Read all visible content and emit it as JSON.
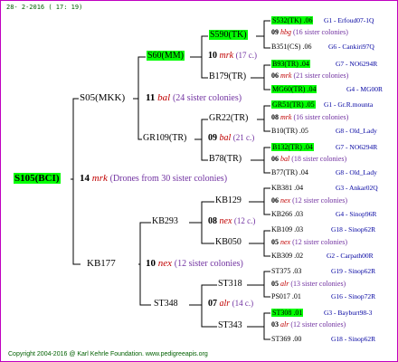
{
  "date": "28-  2-2016  ( 17: 19)",
  "copyright": "Copyright 2004-2016 @ Karl Kehrle Foundation.  www.pedigreeapis.org",
  "root": {
    "id": "S105(BCI)",
    "count": "14",
    "sym": "mrk",
    "note": "(Drones from 30 sister colonies)"
  },
  "l1": {
    "top": {
      "id": "S05(MKK)",
      "count": "11",
      "sym": "bal",
      "note": "(24 sister colonies)"
    },
    "bottom": {
      "id": "KB177",
      "count": "10",
      "sym": "nex",
      "note": "(12 sister colonies)"
    }
  },
  "l2": [
    {
      "id": "S60(MM)",
      "count": "10",
      "sym": "mrk",
      "note": "(17 c.)"
    },
    {
      "id": "GR109(TR)",
      "count": "09",
      "sym": "bal",
      "note": "(21 c.)"
    },
    {
      "id": "KB293",
      "count": "08",
      "sym": "nex",
      "note": "(12 c.)"
    },
    {
      "id": "ST348",
      "count": "07",
      "sym": "alr",
      "note": "(14 c.)"
    }
  ],
  "l3": [
    {
      "id": "S590(TK)"
    },
    {
      "id": "B179(TR)"
    },
    {
      "id": "GR22(TR)"
    },
    {
      "id": "B78(TR)"
    },
    {
      "id": "KB129"
    },
    {
      "id": "KB050"
    },
    {
      "id": "ST318"
    },
    {
      "id": "ST343"
    }
  ],
  "l4": [
    {
      "id": "S532(TK) .06",
      "loc": "G1 - Erfoud07-1Q",
      "count": "09",
      "sym": "hbg",
      "note": "(16 sister colonies)"
    },
    {
      "id": "B351(CS) .06",
      "loc": "G6 - Cankiri97Q"
    },
    {
      "id": "B93(TR) .04",
      "loc": "G7 - NO6294R",
      "count": "06",
      "sym": "mrk",
      "note": "(21 sister colonies)"
    },
    {
      "id": "MG60(TR) .04",
      "loc": "G4 - MG00R"
    },
    {
      "id": "GR51(TR) .05",
      "loc": "G1 - Gr.R.mounta",
      "count": "08",
      "sym": "mrk",
      "note": "(16 sister colonies)"
    },
    {
      "id": "B10(TR) .05",
      "loc": "G8 - Old_Lady"
    },
    {
      "id": "B132(TR) .04",
      "loc": "G7 - NO6294R",
      "count": "06",
      "sym": "bal",
      "note": "(18 sister colonies)"
    },
    {
      "id": "B77(TR) .04",
      "loc": "G8 - Old_Lady"
    },
    {
      "id": "KB381 .04",
      "loc": "G3 - Ankar02Q",
      "count": "06",
      "sym": "nex",
      "note": "(12 sister colonies)"
    },
    {
      "id": "KB266 .03",
      "loc": "G4 - Sinop96R"
    },
    {
      "id": "KB109 .03",
      "loc": "G18 - Sinop62R",
      "count": "05",
      "sym": "nex",
      "note": "(12 sister colonies)"
    },
    {
      "id": "KB309 .02",
      "loc": "G2 - Carpath00R"
    },
    {
      "id": "ST375 .03",
      "loc": "G19 - Sinop62R",
      "count": "05",
      "sym": "alr",
      "note": "(13 sister colonies)"
    },
    {
      "id": "PS017 .01",
      "loc": "G16 - Sinop72R"
    },
    {
      "id": "ST308 .01",
      "loc": "G3 - Bayburt98-3",
      "count": "03",
      "sym": "alr",
      "note": "(12 sister colonies)"
    },
    {
      "id": "ST369 .00",
      "loc": "G18 - Sinop62R"
    }
  ],
  "colors": {
    "highlight": "#00ff00",
    "frame": "#c000c0",
    "symbol": "#c00000",
    "sisters": "#7030a0",
    "location": "#0000a0",
    "footer": "#006000"
  },
  "highlighted": [
    "S105(BCI)",
    "S60(MM)",
    "S590(TK)",
    "S532(TK)",
    "B93(TR)",
    "MG60(TR)",
    "GR51(TR)",
    "B132(TR)",
    "ST308"
  ]
}
